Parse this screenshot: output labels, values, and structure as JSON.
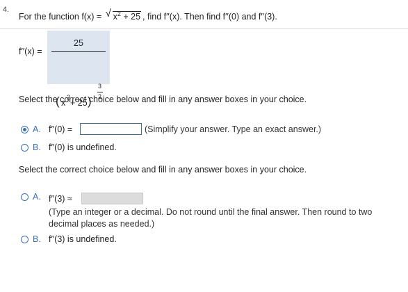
{
  "question_number": "4.",
  "prompt": {
    "pre": "For the function f(x) = ",
    "radicand_x": "x",
    "radicand_exp": "2",
    "radicand_rest": " + 25",
    "post": ", find f′′(x). Then find f′′(0) and f′′(3)."
  },
  "answer": {
    "lhs": "f′′(x) =",
    "numerator": "25",
    "denominator_open": "(",
    "denominator_x": "x",
    "denominator_exp": "2",
    "denominator_rest": "+ 25",
    "denominator_close": ")",
    "power_num": "3",
    "power_den": "2"
  },
  "section1": {
    "instruction": "Select the correct choice below and fill in any answer boxes in your choice.",
    "option_a": {
      "letter": "A.",
      "label": "f′′(0) =",
      "hint": "(Simplify your answer. Type an exact answer.)",
      "selected": true,
      "input_value": ""
    },
    "option_b": {
      "letter": "B.",
      "label": "f′′(0) is undefined.",
      "selected": false
    }
  },
  "section2": {
    "instruction": "Select the correct choice below and fill in any answer boxes in your choice.",
    "option_a": {
      "letter": "A.",
      "label": "f′′(3) ≈",
      "hint_line1": "(Type an integer or a decimal. Do not round until the final answer. Then round to two",
      "hint_line2": "decimal places as needed.)",
      "selected": false,
      "input_value": ""
    },
    "option_b": {
      "letter": "B.",
      "label": "f′′(3) is undefined.",
      "selected": false
    }
  },
  "colors": {
    "accent": "#3a6fb5",
    "answer_bg": "#dde6f0",
    "disabled_input": "#dcdcdc"
  }
}
